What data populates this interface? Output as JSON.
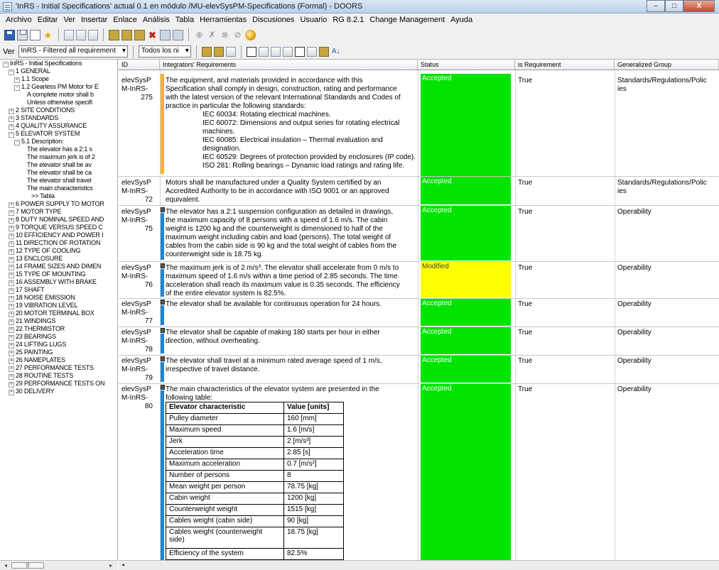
{
  "window": {
    "title": "'InRS - Initial Specifications' actual 0.1 en módulo /MU-elevSysPM-Specifications (Formal) - DOORS",
    "minimize": "–",
    "maximize": "□",
    "close": "X"
  },
  "menu": [
    "Archivo",
    "Editar",
    "Ver",
    "Insertar",
    "Enlace",
    "Análisis",
    "Tabla",
    "Herramientas",
    "Discusiones",
    "Usuario",
    "RG 8.2.1",
    "Change Management",
    "Ayuda"
  ],
  "view_bar": {
    "label": "Ver",
    "view_select": "InRS - Filtered all requirement",
    "level_select": "Todos los ni"
  },
  "tree": {
    "root": "InRS - Initial Specifications",
    "items": [
      {
        "text": "1 GENERAL",
        "sign": "−"
      },
      {
        "text": "1.1 Scope",
        "sign": "+"
      },
      {
        "text": "1.2 Gearless PM Motor for E",
        "sign": "−"
      },
      {
        "text": "A complete motor shall b"
      },
      {
        "text": "Unless otherwise specifi"
      },
      {
        "text": "2 SITE CONDITIONS",
        "sign": "+"
      },
      {
        "text": "3 STANDARDS",
        "sign": "+"
      },
      {
        "text": "4 QUALITY ASSURANCE",
        "sign": "+"
      },
      {
        "text": "5 ELEVATOR SYSTEM",
        "sign": "−"
      },
      {
        "text": "5.1 Description:",
        "sign": "−"
      },
      {
        "text": "The elevator has a 2:1 s"
      },
      {
        "text": "The maximum jerk is of 2"
      },
      {
        "text": "The elevator shall be av"
      },
      {
        "text": "The elevator shall be ca"
      },
      {
        "text": "The elevator shall travel"
      },
      {
        "text": "The main characteristics"
      },
      {
        "text": ">> Tabla"
      },
      {
        "text": "6 POWER SUPPLY TO MOTOR",
        "sign": "+"
      },
      {
        "text": "7 MOTOR TYPE",
        "sign": "+"
      },
      {
        "text": "8 DUTY NOMINAL SPEED AND",
        "sign": "+"
      },
      {
        "text": "9 TORQUE VERSUS SPEED C",
        "sign": "+"
      },
      {
        "text": "10 EFFICIENCY AND POWER I",
        "sign": "+"
      },
      {
        "text": "11 DIRECTION OF ROTATION",
        "sign": "+"
      },
      {
        "text": "12 TYPE OF COOLING",
        "sign": "+"
      },
      {
        "text": "13 ENCLOSURE",
        "sign": "+"
      },
      {
        "text": "14 FRAME SIZES AND DIMEN",
        "sign": "+"
      },
      {
        "text": "15 TYPE OF MOUNTING",
        "sign": "+"
      },
      {
        "text": "16 ASSEMBLY WITH BRAKE",
        "sign": "+"
      },
      {
        "text": "17 SHAFT",
        "sign": "+"
      },
      {
        "text": "18 NOISE EMISSION",
        "sign": "+"
      },
      {
        "text": "19 VIBRATION LEVEL",
        "sign": "+"
      },
      {
        "text": "20 MOTOR TERMINAL BOX",
        "sign": "+"
      },
      {
        "text": "21 WINDINGS",
        "sign": "+"
      },
      {
        "text": "22 THERMISTOR",
        "sign": "+"
      },
      {
        "text": "23 BEARINGS",
        "sign": "+"
      },
      {
        "text": "24 LIFTING LUGS",
        "sign": "+"
      },
      {
        "text": "25 PAINTING",
        "sign": "+"
      },
      {
        "text": "26 NAMEPLATES",
        "sign": "+"
      },
      {
        "text": "27 PERFORMANCE TESTS",
        "sign": "+"
      },
      {
        "text": "28 ROUTINE TESTS",
        "sign": "+"
      },
      {
        "text": "29 PERFORMANCE TESTS ON",
        "sign": "+"
      },
      {
        "text": "30 DELIVERY",
        "sign": "+"
      }
    ]
  },
  "columns": {
    "id": "ID",
    "req": "Integrators' Requirements",
    "status": "Status",
    "isreq": "is Requirement",
    "group": "Generalized Group"
  },
  "rows": [
    {
      "id": "elevSysP",
      "id2": "M-InRS-",
      "id3": "275",
      "status": "Accepted",
      "isreq": "True",
      "group": "Standards/Regulations/Polic",
      "group2": "ies",
      "lines": [
        "The equipment, and materials provided in accordance with this",
        "Specification shall comply in design, construction, rating and performance",
        "with the latest version of the relevant International Standards and Codes of",
        "practice in particular the following standards:"
      ],
      "std": [
        "IEC 60034: Rotating electrical machines.",
        "IEC 60072: Dimensions and output series for rotating electrical",
        "machines.",
        "IEC 60085: Electrical insulation – Thermal evaluation and",
        "designation.",
        "IEC 60529: Degrees of protection provided by enclosures (IP code).",
        "ISO 281: Rolling bearings – Dynamic load ratings and rating life."
      ]
    },
    {
      "id": "elevSysP",
      "id2": "M-InRS-",
      "id3": "72",
      "status": "Accepted",
      "isreq": "True",
      "group": "Standards/Regulations/Polic",
      "group2": "ies",
      "lines": [
        "Motors shall be manufactured under a Quality System certified by an",
        "Accredited Authority to be in accordance with ISO 9001 or an approved",
        "equivalent."
      ]
    },
    {
      "id": "elevSysP",
      "id2": "M-InRS-",
      "id3": "75",
      "status": "Accepted",
      "isreq": "True",
      "group": "Operability",
      "lines": [
        "The elevator has a 2:1 suspension configuration as detailed in drawings,",
        "the maximum capacity of 8 persons with a speed of 1.6 m/s. The cabin",
        "weight is 1200 kg and the counterweight is dimensioned to half of the",
        "maximum weight including cabin and load (persons). The total weight of",
        "cables from the cabin side is 90 kg and the total weight of cables from the",
        "counterweight side is 18.75 kg."
      ]
    },
    {
      "id": "elevSysP",
      "id2": "M-InRS-",
      "id3": "76",
      "status": "Modified",
      "isreq": "True",
      "group": "Operability",
      "lines": [
        "The maximum jerk is of 2 m/s³. The elevator shall accelerate from 0 m/s to",
        "maximum speed of 1.6 m/s within a time period of 2.85 seconds. The time",
        "acceleration shall reach its maximum value is 0.35 seconds. The efficiency",
        "of the entire elevator system is 82.5%."
      ]
    },
    {
      "id": "elevSysP",
      "id2": "M-InRS-",
      "id3": "77",
      "status": "Accepted",
      "isreq": "True",
      "group": "Operability",
      "lines": [
        "The elevator shall be available for continuous operation for 24 hours."
      ]
    },
    {
      "id": "elevSysP",
      "id2": "M-InRS-",
      "id3": "78",
      "status": "Accepted",
      "isreq": "True",
      "group": "Operability",
      "lines": [
        "The elevator shall be capable of making 180 starts per hour in either",
        "direction, without overheating."
      ]
    },
    {
      "id": "elevSysP",
      "id2": "M-InRS-",
      "id3": "79",
      "status": "Accepted",
      "isreq": "True",
      "group": "Operability",
      "lines": [
        "The elevator shall travel at a minimum rated average speed of 1 m/s,",
        "irrespective of travel distance."
      ]
    },
    {
      "id": "elevSysP",
      "id2": "M-InRS-",
      "id3": "80",
      "status": "Accepted",
      "isreq": "True",
      "group": "Operability",
      "lines": [
        "The main characteristics of the elevator system are presented in the",
        "following table:"
      ]
    }
  ],
  "table": {
    "headers": [
      "Elevator characteristic",
      "Value [units]"
    ],
    "rows": [
      [
        "Pulley diameter",
        "160 [mm]"
      ],
      [
        "Maximum speed",
        "1.6 [m/s]"
      ],
      [
        "Jerk",
        "2 [m/s³]"
      ],
      [
        "Acceleration time",
        "2.85 [s]"
      ],
      [
        "Maximum acceleration",
        "0.7 [m/s²]"
      ],
      [
        "Number of persons",
        "8"
      ],
      [
        "Mean weight per person",
        "78.75 [kg]"
      ],
      [
        "Cabin weight",
        "1200 [kg]"
      ],
      [
        "Counterweight weight",
        "1515 [kg]"
      ],
      [
        "Cables weight (cabin side)",
        "90 [kg]"
      ],
      [
        "Cables weight (counterweight",
        "18.75 [kg]"
      ],
      [
        "side)",
        ""
      ],
      [
        "Efficiency of the system",
        "82.5%"
      ]
    ]
  },
  "colors": {
    "accepted": "#00e400",
    "modified": "#fefe00",
    "section_bar": "#1d86d5",
    "heading_bar": "#f5b428"
  }
}
